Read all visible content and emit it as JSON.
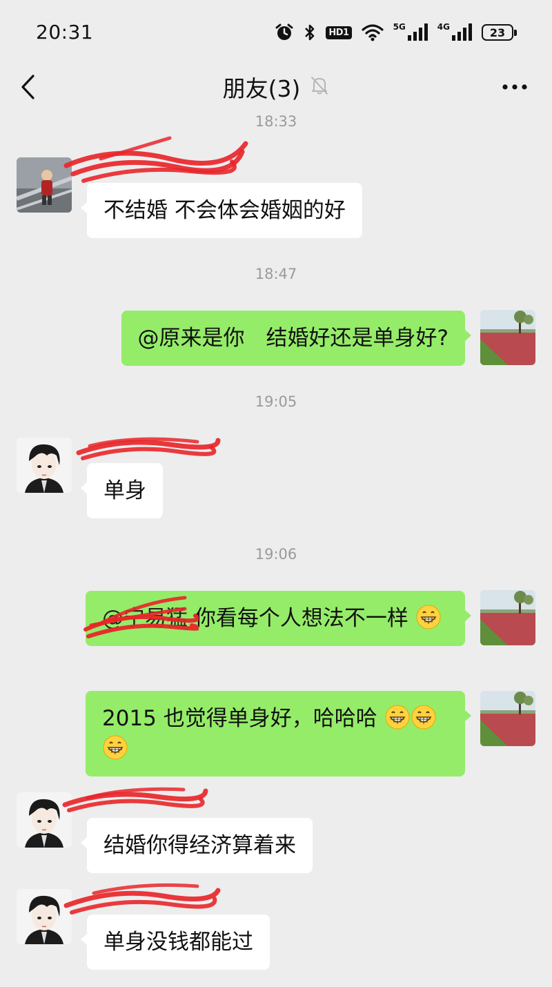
{
  "status_bar": {
    "time": "20:31",
    "network_primary": "5G",
    "network_secondary": "4G",
    "hd_badge": "HD1",
    "battery_level": "23",
    "icons": [
      "alarm-icon",
      "bluetooth-icon",
      "hd-voice-icon",
      "wifi-icon",
      "signal-5g-icon",
      "signal-4g-icon",
      "battery-icon"
    ]
  },
  "nav": {
    "title": "朋友(3)",
    "icons": [
      "back-arrow-icon",
      "mute-bell-icon",
      "more-dots-icon"
    ]
  },
  "messages": [
    {
      "type": "timestamp",
      "text": "18:33"
    },
    {
      "type": "message",
      "direction": "in",
      "sender_redacted": true,
      "text": "不结婚 不会体会婚姻的好"
    },
    {
      "type": "timestamp",
      "text": "18:47"
    },
    {
      "type": "message",
      "direction": "out",
      "text": "@原来是你　结婚好还是单身好?"
    },
    {
      "type": "timestamp",
      "text": "19:05"
    },
    {
      "type": "message",
      "direction": "in",
      "sender_redacted": true,
      "text": "单身"
    },
    {
      "type": "timestamp",
      "text": "19:06"
    },
    {
      "type": "message",
      "direction": "out",
      "text_redacted_prefix": "@宁易猛",
      "text": "你看每个人想法不一样",
      "emoji": [
        "grinning-face"
      ]
    },
    {
      "type": "message",
      "direction": "out",
      "text": "2015 也觉得单身好，哈哈哈",
      "emoji": [
        "grinning-face",
        "grinning-face",
        "grinning-face"
      ]
    },
    {
      "type": "message",
      "direction": "in",
      "sender_redacted": true,
      "text": "结婚你得经济算着来"
    },
    {
      "type": "message",
      "direction": "in",
      "sender_redacted": true,
      "text": "单身没钱都能过"
    }
  ],
  "colors": {
    "background": "#ededed",
    "incoming_bubble": "#ffffff",
    "outgoing_bubble": "#95ec69",
    "timestamp_text": "#9a9a9a",
    "redaction_stroke": "#e8262a"
  }
}
